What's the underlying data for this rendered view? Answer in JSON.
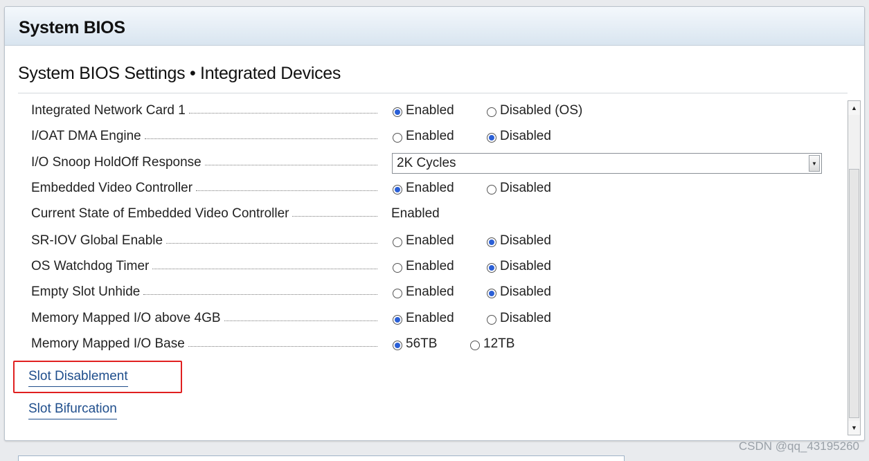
{
  "app_title": "System BIOS",
  "section_title": "System BIOS Settings • Integrated Devices",
  "rows": [
    {
      "label": "Integrated Network Card 1",
      "type": "radio",
      "options": [
        "Enabled",
        "Disabled (OS)"
      ],
      "selected": 0
    },
    {
      "label": "I/OAT DMA Engine",
      "type": "radio",
      "options": [
        "Enabled",
        "Disabled"
      ],
      "selected": 1
    },
    {
      "label": "I/O Snoop HoldOff Response",
      "type": "select",
      "value": "2K Cycles"
    },
    {
      "label": "Embedded Video Controller",
      "type": "radio",
      "options": [
        "Enabled",
        "Disabled"
      ],
      "selected": 0
    },
    {
      "label": "Current State of Embedded Video Controller",
      "type": "static",
      "value": "Enabled"
    },
    {
      "label": "SR-IOV Global Enable",
      "type": "radio",
      "options": [
        "Enabled",
        "Disabled"
      ],
      "selected": 1
    },
    {
      "label": "OS Watchdog Timer",
      "type": "radio",
      "options": [
        "Enabled",
        "Disabled"
      ],
      "selected": 1
    },
    {
      "label": "Empty Slot Unhide",
      "type": "radio",
      "options": [
        "Enabled",
        "Disabled"
      ],
      "selected": 1
    },
    {
      "label": "Memory Mapped I/O above 4GB",
      "type": "radio",
      "options": [
        "Enabled",
        "Disabled"
      ],
      "selected": 0
    },
    {
      "label": "Memory Mapped I/O Base",
      "type": "radio",
      "options": [
        "56TB",
        "12TB"
      ],
      "selected": 0
    }
  ],
  "links": {
    "slot_disablement": "Slot Disablement",
    "slot_bifurcation": "Slot Bifurcation"
  },
  "watermark": "CSDN @qq_43195260",
  "colors": {
    "accent_radio": "#2a5fd6",
    "link": "#1f4e8c",
    "highlight_box": "#e02020",
    "titlebar_bottom": "#d9e5f0"
  }
}
